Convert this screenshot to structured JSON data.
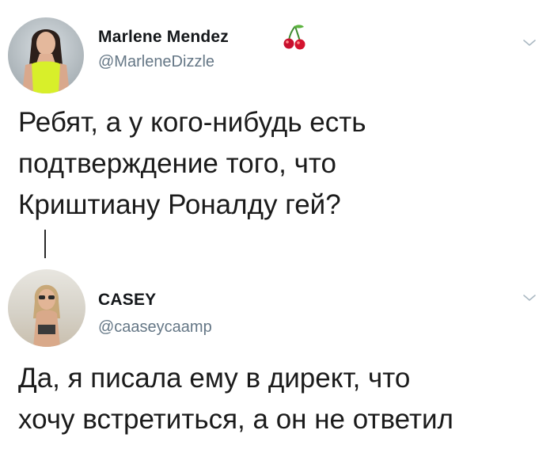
{
  "tweets": [
    {
      "name": "Marlene Mendez",
      "handle": "@MarleneDizzle",
      "name_emoji": "cherries-icon",
      "text": "Ребят, а у кого-нибудь есть\nподтверждение того, что\nКриштиану Роналду гей?"
    },
    {
      "name": "CASEY",
      "handle": "@caaseycaamp",
      "text": "Да, я писала ему в директ, что\nхочу встретиться, а он не ответил"
    }
  ],
  "colors": {
    "name": "#14171a",
    "handle": "#657786",
    "body": "#1b1b1b",
    "chevron": "#aab8c2",
    "thread_line": "#2a2a2a"
  },
  "icons": {
    "menu": "chevron-down-icon"
  }
}
